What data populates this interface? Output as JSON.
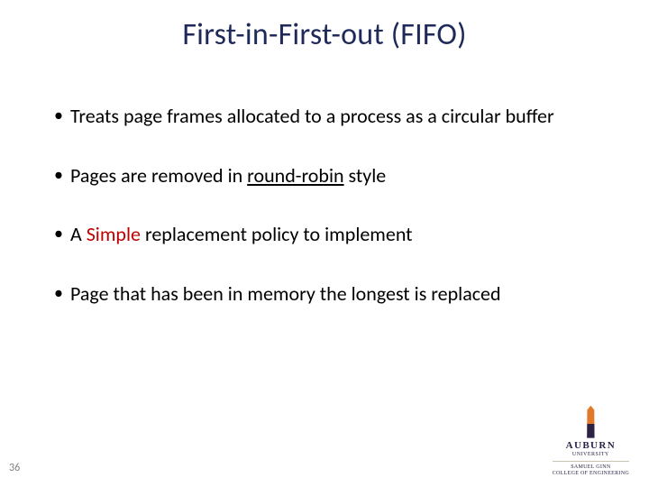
{
  "title": "First-in-First-out (FIFO)",
  "bullets": {
    "b1": "Treats page frames allocated to a process as a circular buffer",
    "b2_pre": "Pages are removed in ",
    "b2_u": "round-robin",
    "b2_post": " style",
    "b3_pre": "A ",
    "b3_red": "Simple",
    "b3_post": " replacement policy to implement",
    "b4": "Page that has been in memory the longest is replaced"
  },
  "page_number": "36",
  "logo": {
    "univ": "AUBURN",
    "sub1": "UNIVERSITY",
    "sub2a": "SAMUEL GINN",
    "sub2b": "COLLEGE OF ENGINEERING"
  }
}
